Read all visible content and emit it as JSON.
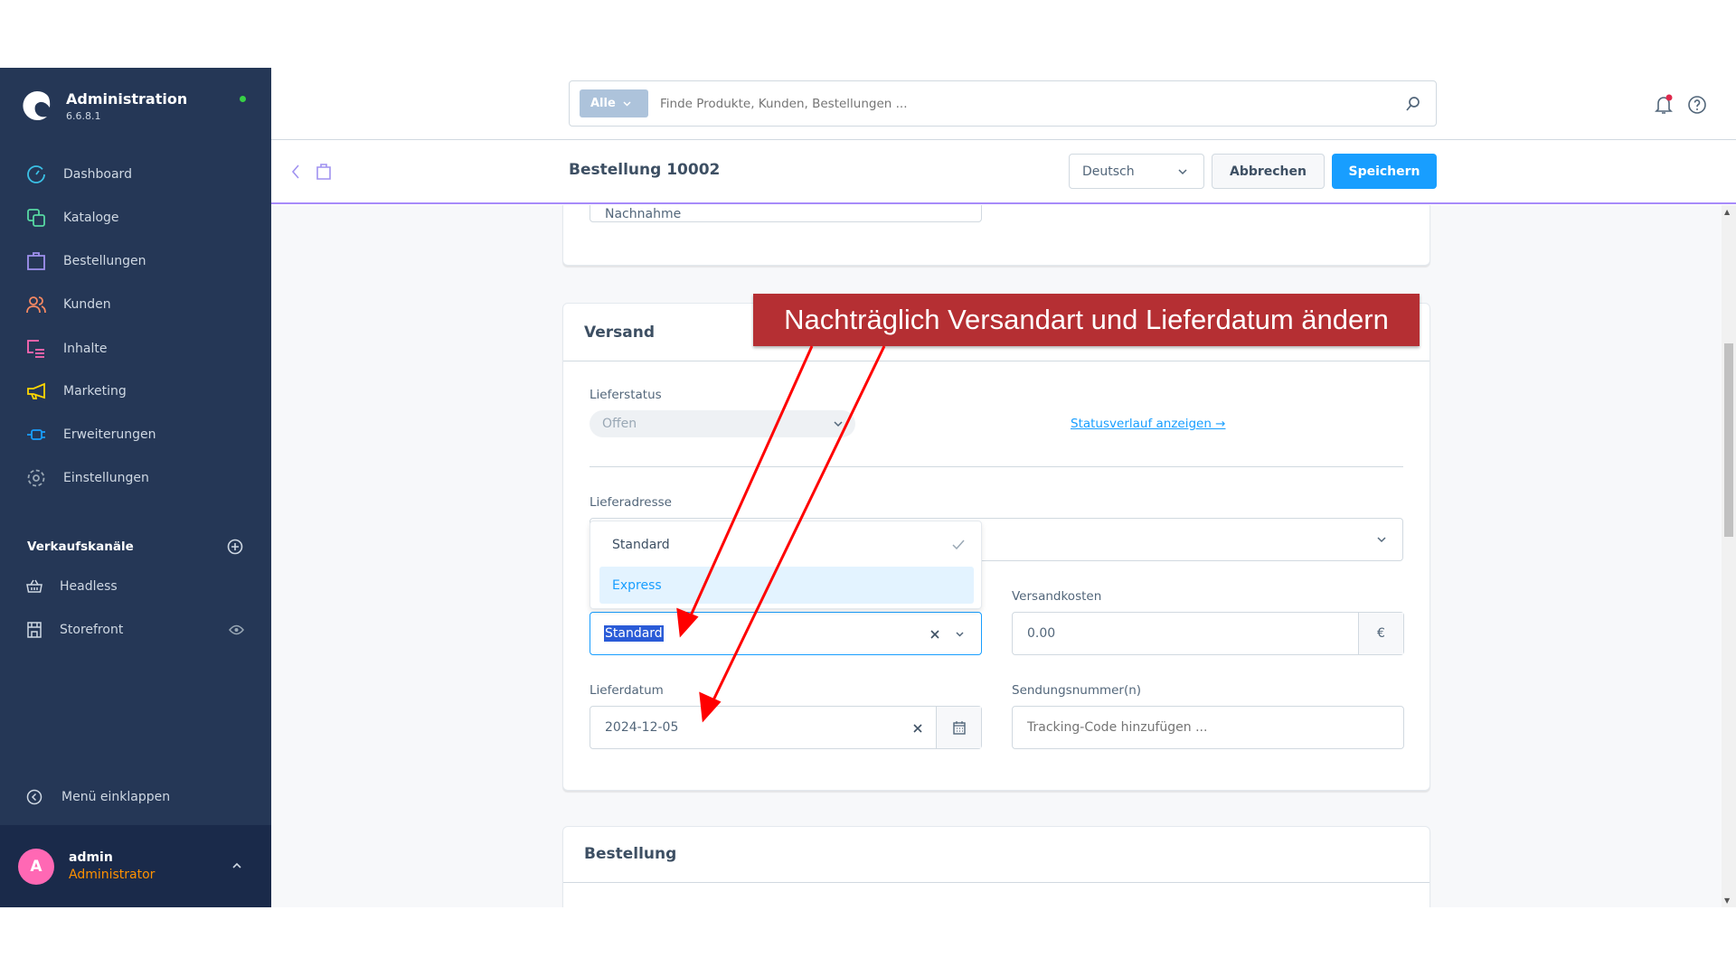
{
  "sidebar": {
    "title": "Administration",
    "version": "6.6.8.1",
    "items": [
      {
        "label": "Dashboard",
        "icon": "dashboard-icon",
        "color": "#3bc1e6"
      },
      {
        "label": "Kataloge",
        "icon": "catalog-icon",
        "color": "#57d9a3"
      },
      {
        "label": "Bestellungen",
        "icon": "bag-icon",
        "color": "#a092f0"
      },
      {
        "label": "Kunden",
        "icon": "users-icon",
        "color": "#f88962"
      },
      {
        "label": "Inhalte",
        "icon": "content-icon",
        "color": "#ff68b4"
      },
      {
        "label": "Marketing",
        "icon": "megaphone-icon",
        "color": "#ffd700"
      },
      {
        "label": "Erweiterungen",
        "icon": "plug-icon",
        "color": "#189eff"
      },
      {
        "label": "Einstellungen",
        "icon": "gear-icon",
        "color": "#9aa8b5"
      }
    ],
    "sales_channels_title": "Verkaufskanäle",
    "channels": [
      {
        "label": "Headless"
      },
      {
        "label": "Storefront"
      }
    ],
    "collapse_label": "Menü einklappen",
    "user": {
      "initial": "A",
      "name": "admin",
      "role": "Administrator"
    }
  },
  "search": {
    "filter": "Alle",
    "placeholder": "Finde Produkte, Kunden, Bestellungen ..."
  },
  "header": {
    "title": "Bestellung 10002",
    "language": "Deutsch",
    "cancel": "Abbrechen",
    "save": "Speichern"
  },
  "content": {
    "prev_field_value": "Nachnahme",
    "versand": {
      "title": "Versand",
      "delivery_status_label": "Lieferstatus",
      "delivery_status": "Offen",
      "status_history_link": "Statusverlauf anzeigen →",
      "address_label": "Lieferadresse",
      "dropdown_options": [
        {
          "label": "Standard",
          "selected": true
        },
        {
          "label": "Express",
          "highlighted": true
        }
      ],
      "shipping_method_value": "Standard",
      "shipping_cost_label": "Versandkosten",
      "shipping_cost": "0.00",
      "currency": "€",
      "delivery_date_label": "Lieferdatum",
      "delivery_date": "2024-12-05",
      "tracking_label": "Sendungsnummer(n)",
      "tracking_placeholder": "Tracking-Code hinzufügen ..."
    },
    "order": {
      "title": "Bestellung"
    }
  },
  "annotation": {
    "text": "Nachträglich Versandart und Lieferdatum ändern",
    "color": "#b52f33",
    "arrow_color": "#ff0000"
  }
}
